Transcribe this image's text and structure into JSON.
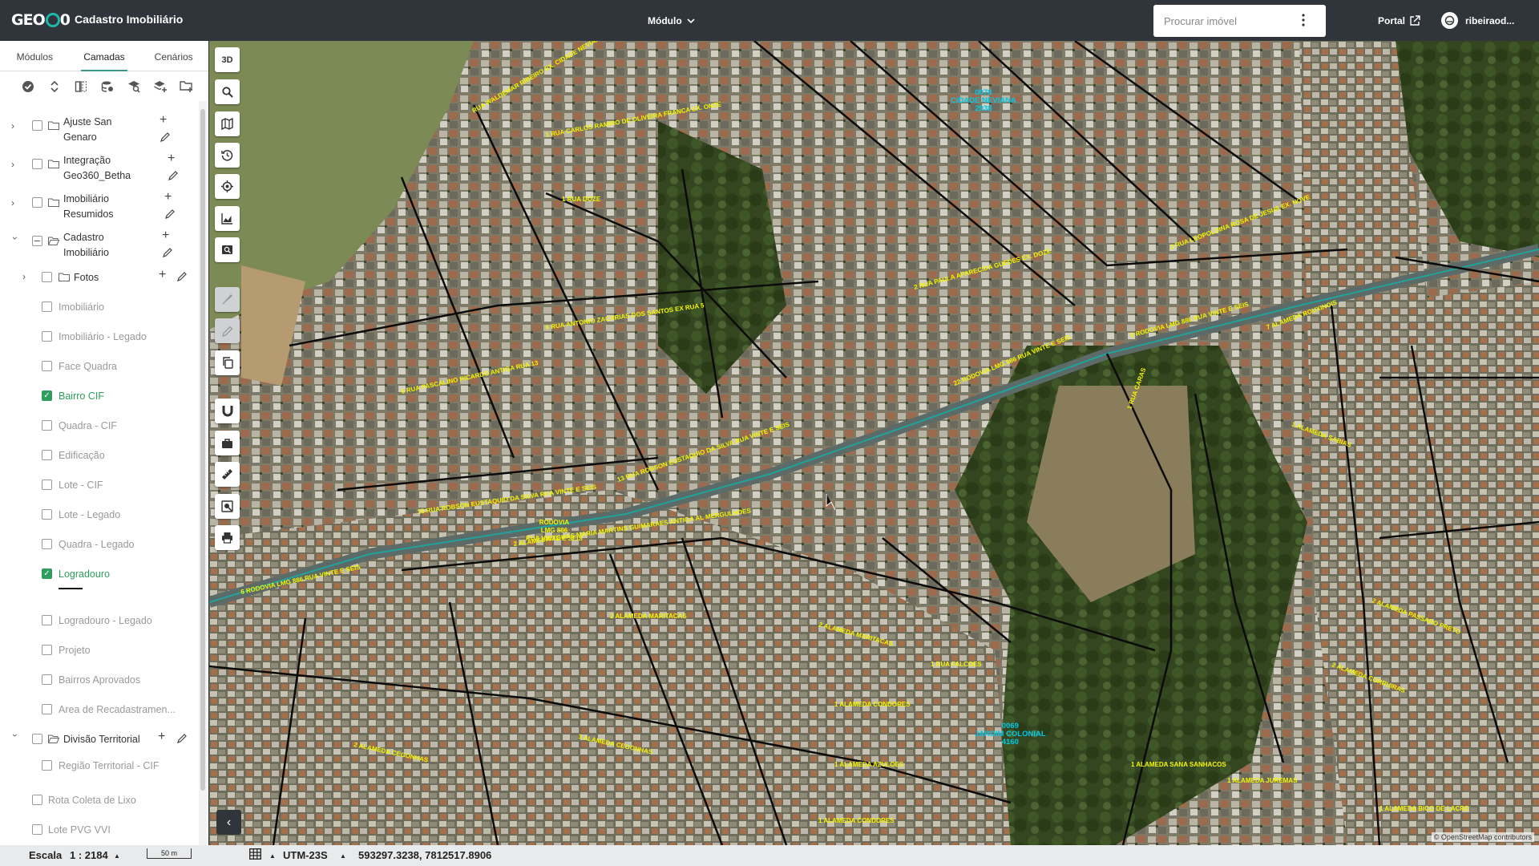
{
  "header": {
    "logo": "GEO360",
    "app_title": "Cadastro Imobiliário",
    "module_label": "Módulo",
    "search_placeholder": "Procurar imóvel",
    "portal_label": "Portal",
    "user_name": "ribeiraod..."
  },
  "sidebar": {
    "tabs": [
      {
        "label": "Módulos"
      },
      {
        "label": "Camadas"
      },
      {
        "label": "Cenários"
      }
    ],
    "active_tab": "Camadas",
    "layers": {
      "ajuste": {
        "label_1": "Ajuste San",
        "label_2": "Genaro"
      },
      "integracao": {
        "label_1": "Integração",
        "label_2": "Geo360_Betha"
      },
      "imobiliario_resumidos": {
        "label_1": "Imobiliário",
        "label_2": "Resumidos"
      },
      "cadastro": {
        "label_1": "Cadastro",
        "label_2": "Imobiliário"
      },
      "fotos": "Fotos",
      "imobiliario": "Imobiliário",
      "imobiliario_legado": "Imobiliário - Legado",
      "face_quadra": "Face Quadra",
      "bairro_cif": "Bairro CIF",
      "quadra_cif": "Quadra - CIF",
      "edificacao": "Edificação",
      "lote_cif": "Lote - CIF",
      "lote_legado": "Lote - Legado",
      "quadra_legado": "Quadra - Legado",
      "logradouro": "Logradouro",
      "logradouro_legado": "Logradouro - Legado",
      "projeto": "Projeto",
      "bairros_aprovados": "Bairros Aprovados",
      "area_recadastramento": "Area de Recadastramen...",
      "divisao_territorial": "Divisão Territorial",
      "regiao_territorial": "Região Territorial - CIF",
      "rota_coleta": "Rota Coleta de Lixo",
      "lote_pvg": "Lote PVG VVI"
    }
  },
  "map": {
    "control_3d": "3D",
    "attribution": "© OpenStreetMap contributors",
    "poi_1": {
      "code": "0078",
      "name": "CIDADE NEVIANA",
      "num": "2938"
    },
    "poi_2": {
      "code": "0069",
      "name": "JARDIM COLONIAL",
      "num": "4160"
    },
    "rodovia_label": "RODOVIA\nLMG 886\nRUA VINTE E SEIS"
  },
  "status": {
    "scale_label": "Escala",
    "scale_value": "1 : 2184",
    "scalebar_text": "50 m",
    "projection": "UTM-23S",
    "coordinates": "593297.3238, 7812517.8906"
  },
  "colors": {
    "header_bg": "#2f353a",
    "accent": "#1fb8a8",
    "checkbox_on": "#2e9e5c",
    "road_label": "#f5f500"
  }
}
